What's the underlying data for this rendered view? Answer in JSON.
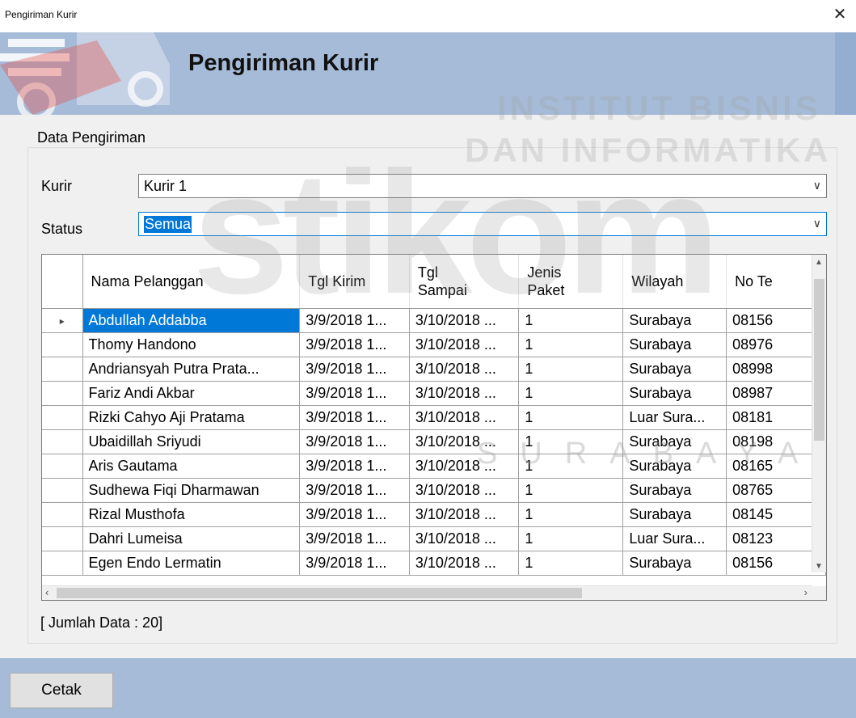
{
  "window": {
    "title": "Pengiriman Kurir",
    "close_glyph": "✕"
  },
  "header": {
    "title": "Pengiriman Kurir",
    "icon": "delivery-truck-icon"
  },
  "watermark": {
    "logo": "stikom",
    "line1": "INSTITUT BISNIS",
    "line2": "DAN INFORMATIKA",
    "line3": "SURABAYA"
  },
  "group": {
    "legend": "Data Pengiriman"
  },
  "filters": {
    "kurir_label": "Kurir",
    "kurir_value": "Kurir 1",
    "status_label": "Status",
    "status_value": "Semua"
  },
  "grid": {
    "columns": [
      "Nama Pelanggan",
      "Tgl Kirim",
      "Tgl\nSampai",
      "Jenis\nPaket",
      "Wilayah",
      "No Te"
    ],
    "rows": [
      [
        "Abdullah Addabba",
        "3/9/2018 1...",
        "3/10/2018 ...",
        "1",
        "Surabaya",
        "08156"
      ],
      [
        "Thomy Handono",
        "3/9/2018 1...",
        "3/10/2018 ...",
        "1",
        "Surabaya",
        "08976"
      ],
      [
        "Andriansyah Putra Prata...",
        "3/9/2018 1...",
        "3/10/2018 ...",
        "1",
        "Surabaya",
        "08998"
      ],
      [
        "Fariz Andi Akbar",
        "3/9/2018 1...",
        "3/10/2018 ...",
        "1",
        "Surabaya",
        "08987"
      ],
      [
        "Rizki Cahyo Aji Pratama",
        "3/9/2018 1...",
        "3/10/2018 ...",
        "1",
        "Luar Sura...",
        "08181"
      ],
      [
        "Ubaidillah Sriyudi",
        "3/9/2018 1...",
        "3/10/2018 ...",
        "1",
        "Surabaya",
        "08198"
      ],
      [
        "Aris Gautama",
        "3/9/2018 1...",
        "3/10/2018 ...",
        "1",
        "Surabaya",
        "08165"
      ],
      [
        "Sudhewa Fiqi Dharmawan",
        "3/9/2018 1...",
        "3/10/2018 ...",
        "1",
        "Surabaya",
        "08765"
      ],
      [
        "Rizal Musthofa",
        "3/9/2018 1...",
        "3/10/2018 ...",
        "1",
        "Surabaya",
        "08145"
      ],
      [
        "Dahri Lumeisa",
        "3/9/2018 1...",
        "3/10/2018 ...",
        "1",
        "Luar Sura...",
        "08123"
      ],
      [
        "Egen Endo Lermatin",
        "3/9/2018 1...",
        "3/10/2018 ...",
        "1",
        "Surabaya",
        "08156"
      ]
    ],
    "selected_row": 0,
    "row_indicator": "▸"
  },
  "count_text": "[ Jumlah Data : 20]",
  "footer": {
    "print_label": "Cetak"
  },
  "colors": {
    "header_band": "#a6bbd7",
    "selection": "#0078d7"
  }
}
